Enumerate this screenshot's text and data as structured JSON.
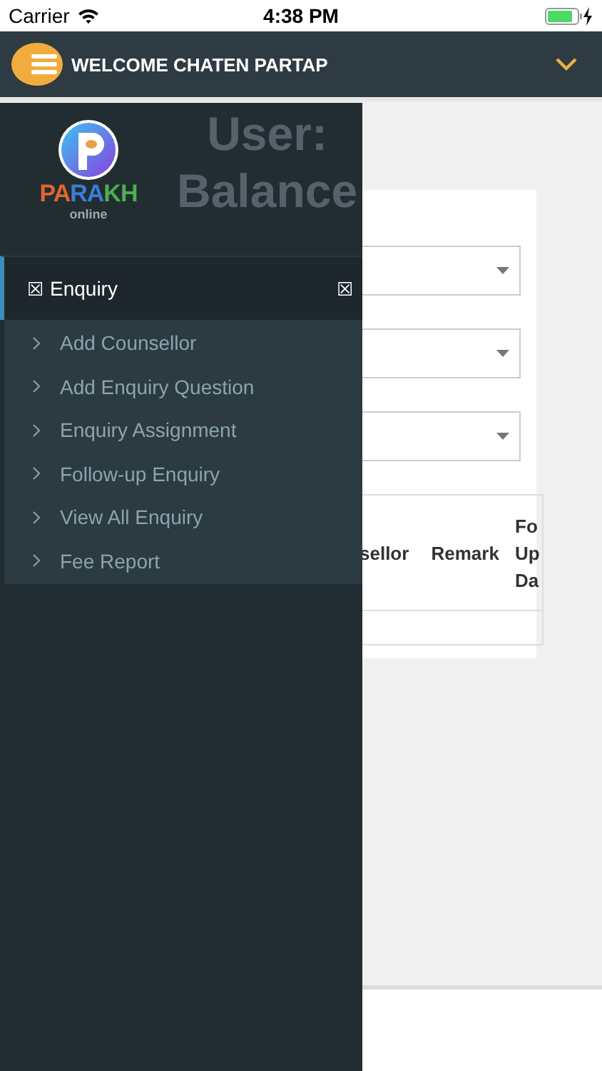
{
  "status_bar": {
    "carrier": "Carrier",
    "time": "4:38 PM"
  },
  "header": {
    "title": "WELCOME CHATEN PARTAP"
  },
  "page": {
    "title_lines": [
      "User:",
      "Balance"
    ],
    "dropdowns": [
      {
        "kind": "select"
      },
      {
        "kind": "select"
      },
      {
        "kind": "select"
      }
    ],
    "table": {
      "columns": [
        "sellor",
        "Remark",
        "Fo Up Da"
      ]
    }
  },
  "drawer": {
    "logo": {
      "wordmark": "PARAKH",
      "tagline": "online"
    },
    "menu": [
      {
        "icon": "☒",
        "label": "Enquiry",
        "toggle": "☒",
        "expanded": true,
        "selected": true,
        "children": [
          {
            "label": "Add Counsellor"
          },
          {
            "label": "Add Enquiry Question"
          },
          {
            "label": "Enquiry Assignment"
          },
          {
            "label": "Follow-up Enquiry"
          },
          {
            "label": "View All Enquiry"
          },
          {
            "label": "Fee Report"
          }
        ]
      }
    ]
  }
}
